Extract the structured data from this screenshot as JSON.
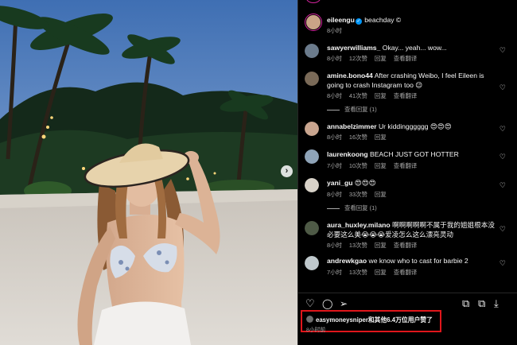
{
  "post": {
    "author": "eileengu",
    "caption": "beachday ©",
    "time": "8小时"
  },
  "comments": [
    {
      "user": "sawyerwilliams_",
      "text": "Okay... yeah... wow...",
      "time": "8小时",
      "likes": "12次赞",
      "reply": "回复",
      "translate": "查看翻译",
      "avatar_color": "#6b7b8c"
    },
    {
      "user": "amine.bono44",
      "text": "After crashing Weibo, I feel Eileen is going to crash Instagram too 😉",
      "time": "8小时",
      "likes": "41次赞",
      "reply": "回复",
      "translate": "查看翻译",
      "view_replies": "查看回复 (1)",
      "avatar_color": "#7a6a58"
    },
    {
      "user": "annabelzimmer",
      "text": "Ur kiddingggggg 😍😍😍",
      "time": "8小时",
      "likes": "16次赞",
      "reply": "回复",
      "view_replies": "查看回复 (1)",
      "avatar_color": "#c9a58f"
    },
    {
      "user": "laurenkoong",
      "text": "BEACH JUST GOT HOTTER",
      "time": "7小时",
      "likes": "10次赞",
      "reply": "回复",
      "translate": "查看翻译",
      "avatar_color": "#8fa4b8"
    },
    {
      "user": "yani_gu",
      "text": "😍😍😍",
      "time": "8小时",
      "likes": "33次赞",
      "reply": "回复",
      "view_replies": "查看回复 (1)",
      "avatar_color": "#d8d2c8"
    },
    {
      "user": "aura_huxley.milano",
      "text": "啊啊啊啊啊不属于我的姐姐根本没必要这么美😭😭😭爱凌怎么这么漂亮灵动",
      "time": "8小时",
      "likes": "13次赞",
      "reply": "回复",
      "translate": "查看翻译",
      "avatar_color": "#4e5a46"
    },
    {
      "user": "andrewkgao",
      "text": "we know who to cast for barbie 2",
      "time": "7小时",
      "likes": "13次赞",
      "reply": "回复",
      "translate": "查看翻译",
      "avatar_color": "#bfc8cc"
    }
  ],
  "actions": {
    "like_icon": "♡",
    "comment_icon": "◯",
    "share_icon": "➢",
    "reel_icon": "⧉",
    "collect_icon": "⧉",
    "download_icon": "⤓",
    "heart_small": "♡",
    "next_icon": "›"
  },
  "likes": {
    "text": "easymoneysniper和其他6.4万位用户赞了",
    "time": "8小时前"
  },
  "colors": {
    "highlight": "#e0161b",
    "ring": "#d6249f",
    "verified": "#0095f6"
  }
}
